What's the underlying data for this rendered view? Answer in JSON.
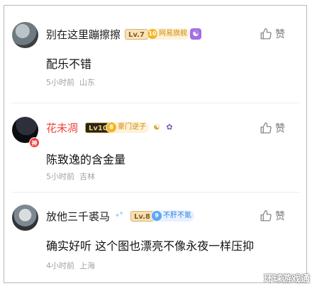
{
  "comments": [
    {
      "username": "别在这里蹦擦擦",
      "level": "Lv.7",
      "tag": {
        "icon": "10",
        "text": "网易旗舰"
      },
      "extras": [
        "☯"
      ],
      "text": "配乐不错",
      "time": "5小时前",
      "location": "山东",
      "like_label": "赞"
    },
    {
      "username": "花未凋",
      "avatar_badge": "神",
      "level": "Lv10",
      "tag": {
        "icon": "8",
        "text": "豪门逆子"
      },
      "extras": [
        "☯",
        "✿"
      ],
      "text": "陈致逸的含金量",
      "time": "5小时前",
      "location": "吉林",
      "like_label": "赞"
    },
    {
      "username": "放他三千裘马",
      "level": "Lv.8",
      "tag": {
        "icon": "9",
        "text": "不肝不氪"
      },
      "extras": [
        "∘°"
      ],
      "text": "确实好听 这个图也漂亮不像永夜一样压抑",
      "time": "4小时前",
      "location": "上海",
      "like_label": "赞"
    }
  ],
  "watermark": "环球游戏通",
  "colors": {
    "vip_name": "#f0413a",
    "meta_gray": "#a3a3a3"
  }
}
